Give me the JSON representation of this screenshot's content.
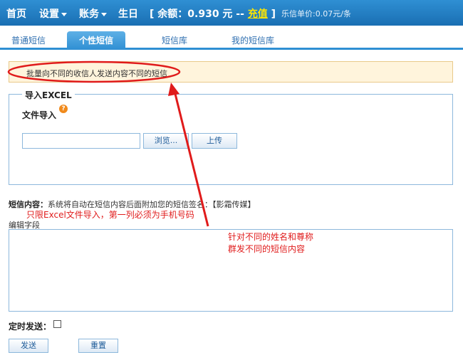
{
  "nav": {
    "home": "首页",
    "settings": "设置",
    "account": "账务",
    "birthday": "生日",
    "balance_prefix": "[ 余额：0.930 元 -- ",
    "recharge": "充值",
    "balance_suffix": " ]",
    "price": "乐信单价:0.07元/条"
  },
  "tabs": [
    "普通短信",
    "个性短信",
    "短信库",
    "我的短信库"
  ],
  "tip": "批量向不同的收信人发送内容不同的短信",
  "excel": {
    "legend": "导入EXCEL",
    "file_label": "文件导入",
    "browse": "浏览...",
    "upload": "上传"
  },
  "content": {
    "label": "短信内容：",
    "text": "系统将自动在短信内容后面附加您的短信签名：【影霜传媒】",
    "edit_label": "编辑字段"
  },
  "annotations": {
    "note1": "只限Excel文件导入，第一列必须为手机号码",
    "note2_line1": "针对不同的姓名和尊称",
    "note2_line2": "群发不同的短信内容"
  },
  "timer_label": "定时发送：",
  "buttons": {
    "send": "发送",
    "reset": "重置"
  },
  "colors": {
    "nav": "#1a6fb3",
    "accent": "#2f8fd3",
    "annotation": "#e01b1b",
    "tip_bg": "#fff4dc"
  }
}
